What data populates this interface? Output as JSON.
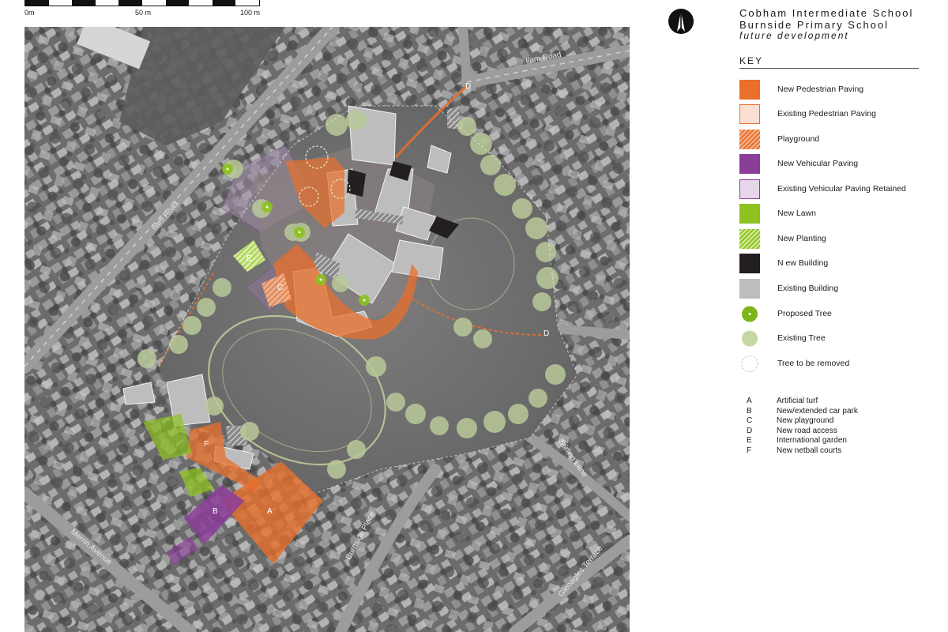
{
  "scale": {
    "labels": [
      "0m",
      "50 m",
      "100 m"
    ]
  },
  "titles": {
    "line1": "Cobham Intermediate School",
    "line2": "Burnside Primary School",
    "line3": "future development"
  },
  "key": {
    "heading": "KEY",
    "items": [
      {
        "label": "New Pedestrian Paving",
        "color": "#e96f2b",
        "style": "solid"
      },
      {
        "label": "Existing Pedestrian Paving",
        "color": "#fbe0d2",
        "style": "outlined",
        "stroke": "#e96f2b"
      },
      {
        "label": "Playground",
        "color": "#e96f2b",
        "style": "hatched"
      },
      {
        "label": "New Vehicular Paving",
        "color": "#8b3d9a",
        "style": "solid"
      },
      {
        "label": "Existing Vehicular Paving Retained",
        "color": "#e6d6ea",
        "style": "outlined",
        "stroke": "#8b3d9a"
      },
      {
        "label": "New Lawn",
        "color": "#8dc21f",
        "style": "solid"
      },
      {
        "label": "New Planting",
        "color": "#8dc21f",
        "style": "hatched"
      },
      {
        "label": "N ew Building",
        "color": "#231f20",
        "style": "solid"
      },
      {
        "label": "Existing Building",
        "color": "#bdbdbd",
        "style": "solid"
      },
      {
        "label": "Proposed Tree",
        "color": "#7cb518",
        "style": "tree-proposed"
      },
      {
        "label": "Existing Tree",
        "color": "#c5d8a4",
        "style": "tree-existing"
      },
      {
        "label": "Tree to be removed",
        "color": "#c5d8a4",
        "style": "tree-removed"
      }
    ]
  },
  "notes": [
    {
      "key": "A",
      "text": "Artificial turf"
    },
    {
      "key": "B",
      "text": "New/extended car park"
    },
    {
      "key": "C",
      "text": "New playground"
    },
    {
      "key": "D",
      "text": "New road access"
    },
    {
      "key": "E",
      "text": "International garden"
    },
    {
      "key": "F",
      "text": "New netball courts"
    }
  ],
  "map": {
    "roads": [
      "Ilam Road",
      "Ilam Road",
      "Merrin Avenue",
      "Burnside Place",
      "Glenagles Terrace",
      "Stirling Lane"
    ],
    "zones": [
      "A",
      "B",
      "C",
      "D",
      "D",
      "E",
      "F"
    ]
  }
}
